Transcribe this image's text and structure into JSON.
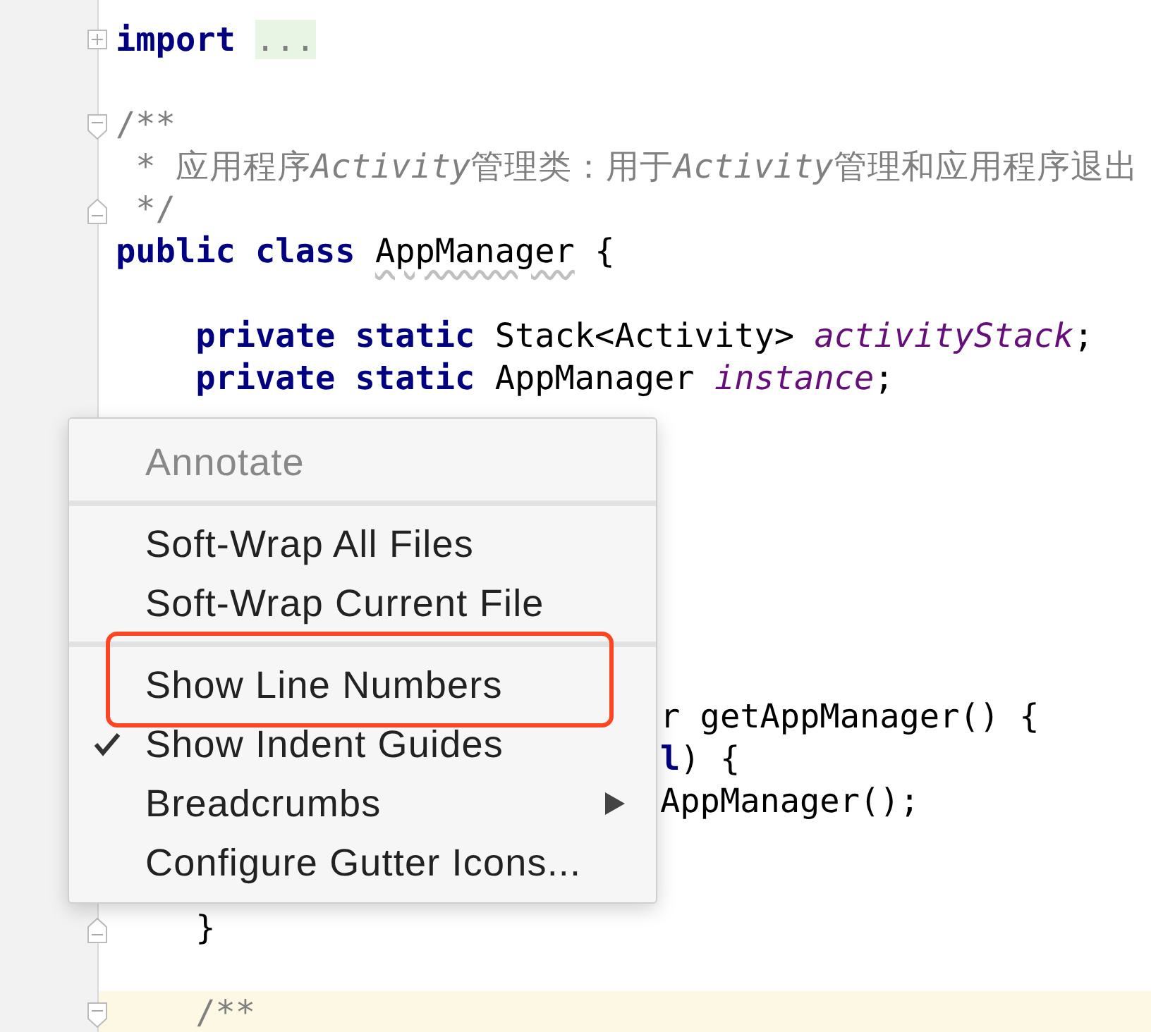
{
  "editor": {
    "lines": [
      {
        "kind": "code",
        "fold_start": true,
        "collapsed": true,
        "segments": [
          {
            "text": "import ",
            "kind": "keyword"
          },
          {
            "text": "...",
            "kind": "folded"
          }
        ]
      },
      {
        "kind": "blank"
      },
      {
        "kind": "code",
        "fold_start": true,
        "segments": [
          {
            "text": "/**",
            "kind": "comment"
          }
        ]
      },
      {
        "kind": "code",
        "segments": [
          {
            "text": " * 应用程序",
            "kind": "comment"
          },
          {
            "text": "Activity",
            "kind": "comment_italic"
          },
          {
            "text": "管理类：用于",
            "kind": "comment"
          },
          {
            "text": "Activity",
            "kind": "comment_italic"
          },
          {
            "text": "管理和应用程序退出",
            "kind": "comment"
          }
        ]
      },
      {
        "kind": "code",
        "fold_end": true,
        "segments": [
          {
            "text": " */",
            "kind": "comment"
          }
        ]
      },
      {
        "kind": "code",
        "segments": [
          {
            "text": "public class ",
            "kind": "keyword"
          },
          {
            "text": "AppManager",
            "kind": "warning"
          },
          {
            "text": " {",
            "kind": "plain"
          }
        ]
      },
      {
        "kind": "blank"
      },
      {
        "kind": "code",
        "segments": [
          {
            "text": "    private static",
            "kind": "keyword"
          },
          {
            "text": " Stack<Activity> ",
            "kind": "plain"
          },
          {
            "text": "activityStack",
            "kind": "field"
          },
          {
            "text": ";",
            "kind": "plain"
          }
        ]
      },
      {
        "kind": "code",
        "segments": [
          {
            "text": "    private static",
            "kind": "keyword"
          },
          {
            "text": " AppManager ",
            "kind": "plain"
          },
          {
            "text": "instance",
            "kind": "field"
          },
          {
            "text": ";",
            "kind": "plain"
          }
        ]
      },
      {
        "kind": "blank"
      },
      {
        "kind": "blank"
      },
      {
        "kind": "blank"
      },
      {
        "kind": "blank"
      },
      {
        "kind": "blank"
      },
      {
        "kind": "blank"
      },
      {
        "kind": "blank"
      },
      {
        "kind": "partial",
        "segments": [
          {
            "text": "r getAppManager() {",
            "kind": "plain"
          }
        ]
      },
      {
        "kind": "partial",
        "segments": [
          {
            "text": "l",
            "kind": "keyword"
          },
          {
            "text": ") {",
            "kind": "plain"
          }
        ]
      },
      {
        "kind": "partial",
        "segments": [
          {
            "text": "AppManager();",
            "kind": "plain"
          }
        ]
      },
      {
        "kind": "blank"
      },
      {
        "kind": "blank"
      },
      {
        "kind": "code",
        "fold_end": true,
        "segments": [
          {
            "text": "    }",
            "kind": "plain"
          }
        ]
      },
      {
        "kind": "blank"
      },
      {
        "kind": "code",
        "fold_start": true,
        "current": true,
        "segments": [
          {
            "text": "    /**",
            "kind": "comment"
          }
        ]
      }
    ]
  },
  "context_menu": {
    "items": [
      {
        "kind": "item",
        "label": "Annotate",
        "disabled": true,
        "checked": false,
        "submenu": false,
        "highlighted": false
      },
      {
        "kind": "separator"
      },
      {
        "kind": "item",
        "label": "Soft-Wrap All Files",
        "disabled": false,
        "checked": false,
        "submenu": false,
        "highlighted": false
      },
      {
        "kind": "item",
        "label": "Soft-Wrap Current File",
        "disabled": false,
        "checked": false,
        "submenu": false,
        "highlighted": false
      },
      {
        "kind": "separator"
      },
      {
        "kind": "item",
        "label": "Show Line Numbers",
        "disabled": false,
        "checked": false,
        "submenu": false,
        "highlighted": true
      },
      {
        "kind": "item",
        "label": "Show Indent Guides",
        "disabled": false,
        "checked": true,
        "submenu": false,
        "highlighted": false
      },
      {
        "kind": "item",
        "label": "Breadcrumbs",
        "disabled": false,
        "checked": false,
        "submenu": true,
        "highlighted": false
      },
      {
        "kind": "item",
        "label": "Configure Gutter Icons...",
        "disabled": false,
        "checked": false,
        "submenu": false,
        "highlighted": false
      }
    ]
  }
}
